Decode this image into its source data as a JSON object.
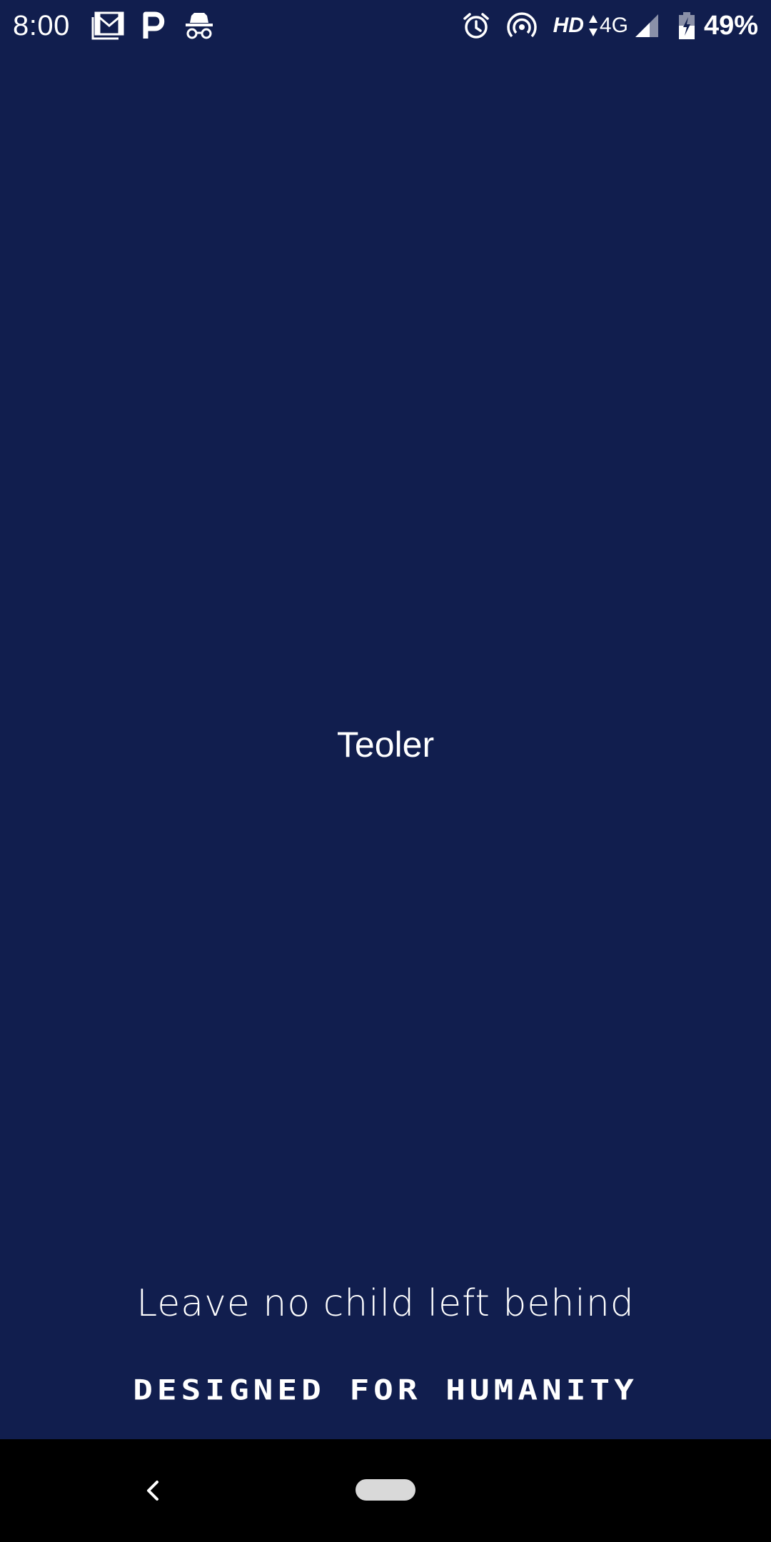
{
  "status_bar": {
    "time": "8:00",
    "left_icons": [
      "gmail-icon",
      "parking-p-icon",
      "incognito-icon"
    ],
    "right_icons": [
      "alarm-icon",
      "hotspot-icon",
      "signal-icon",
      "battery-icon"
    ],
    "hd_label": "HD",
    "network_label": "4G",
    "battery_percent": "49%"
  },
  "splash": {
    "app_name": "Teoler",
    "tagline": "Leave no child left behind",
    "brand_line": "DESIGNED FOR HUMANITY"
  },
  "colors": {
    "background": "#111e4e",
    "text": "#ffffff",
    "nav_bar": "#000000",
    "home_pill": "#d9d9d9"
  },
  "nav_bar": {
    "icons": [
      "back-chevron-icon",
      "home-pill-icon"
    ]
  }
}
